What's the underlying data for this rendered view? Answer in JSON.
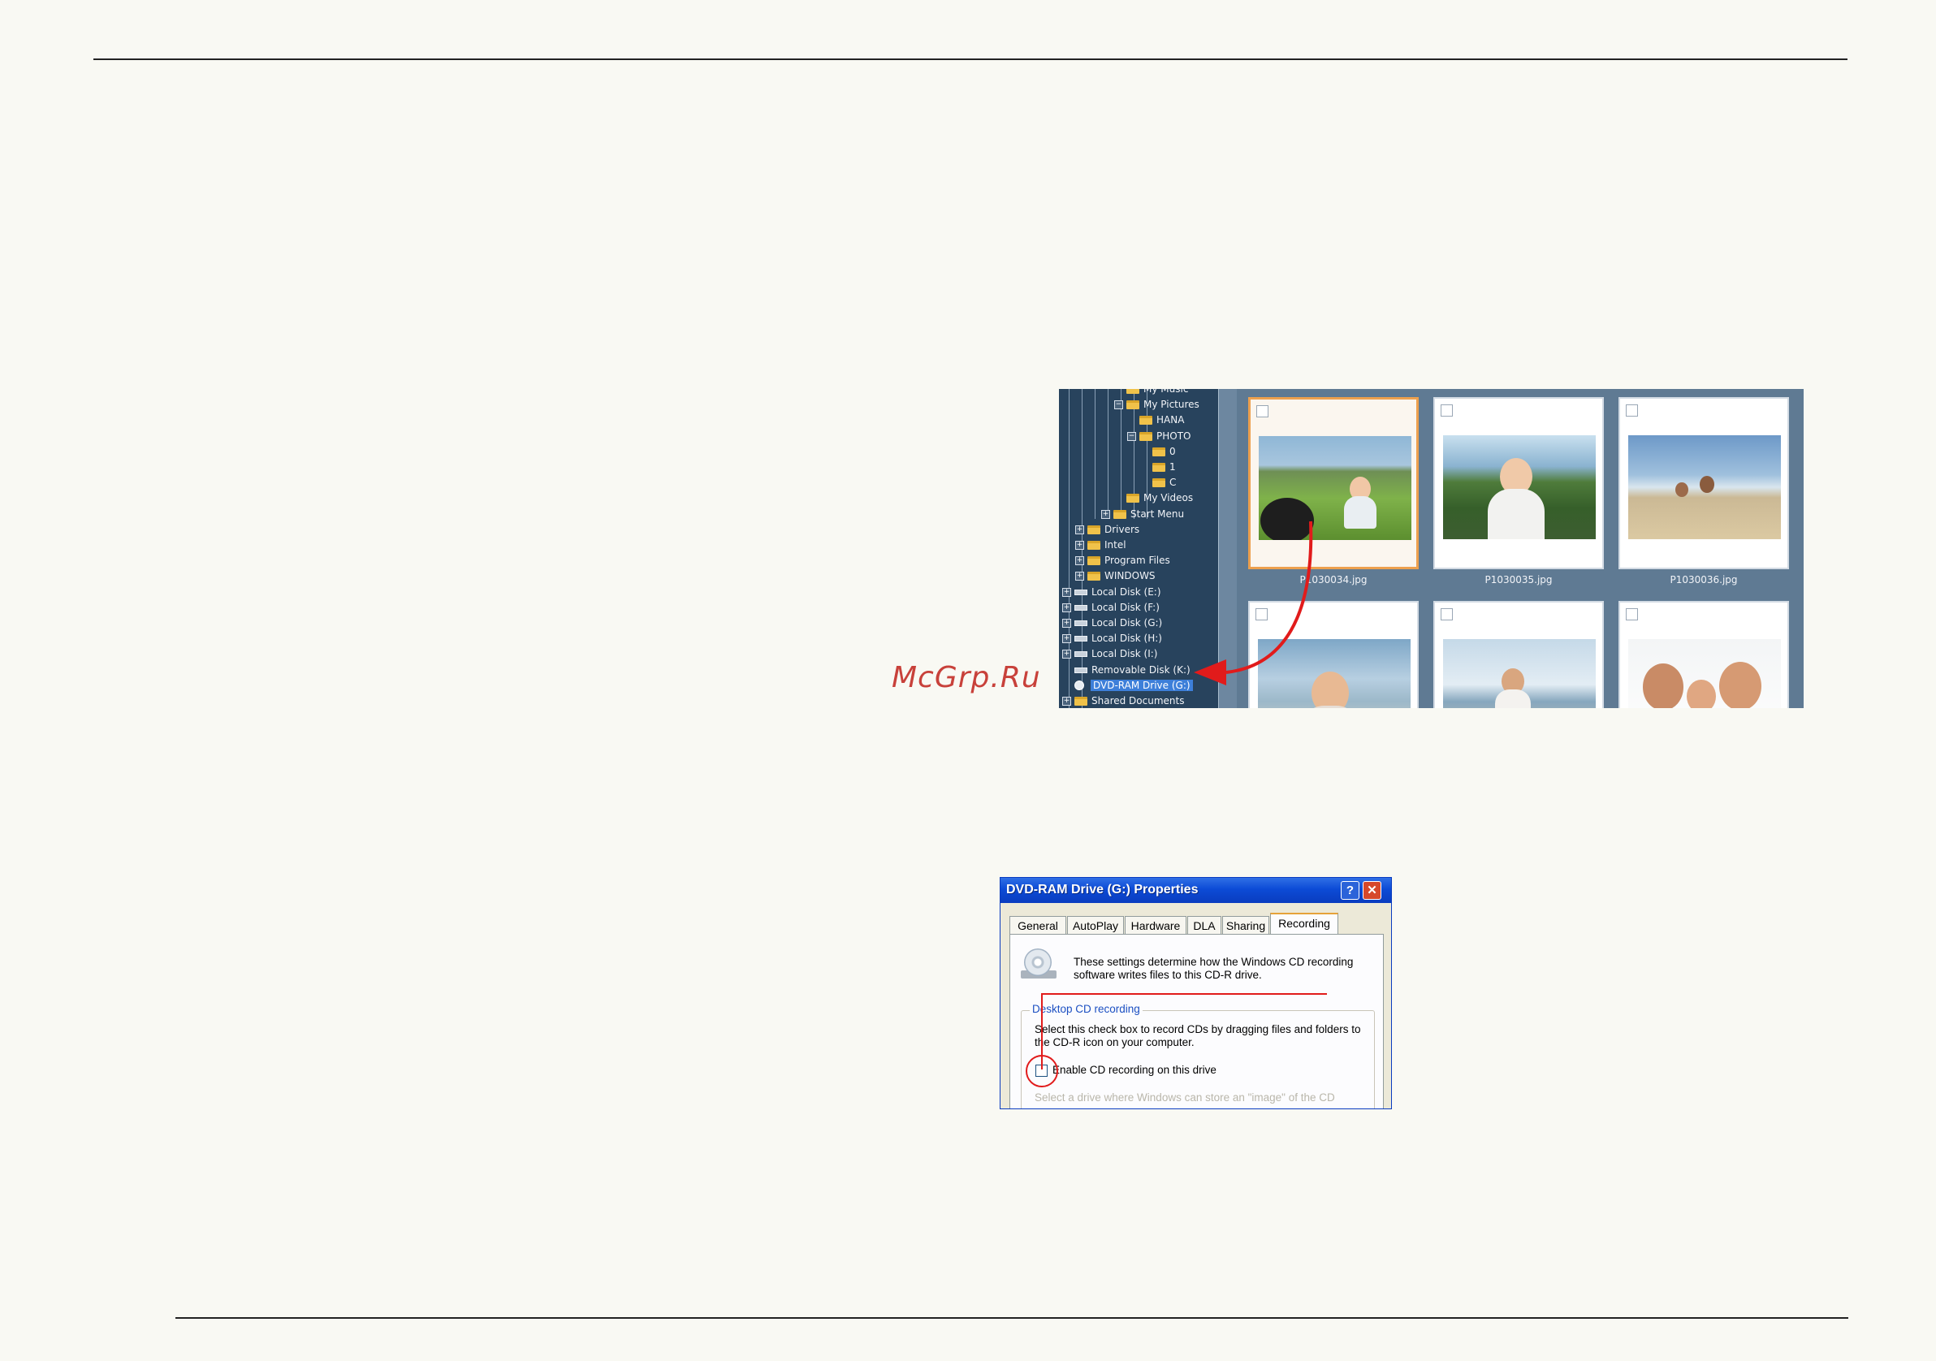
{
  "watermark": "McGrp.Ru",
  "explorer": {
    "tree": [
      {
        "label": "My Music",
        "depth": 4,
        "icon": "folder"
      },
      {
        "label": "My Pictures",
        "depth": 4,
        "icon": "folder",
        "expander": "−"
      },
      {
        "label": "HANA",
        "depth": 5,
        "icon": "folder"
      },
      {
        "label": "PHOTO",
        "depth": 5,
        "icon": "folder",
        "expander": "−"
      },
      {
        "label": "0",
        "depth": 6,
        "icon": "folder"
      },
      {
        "label": "1",
        "depth": 6,
        "icon": "folder"
      },
      {
        "label": "C",
        "depth": 6,
        "icon": "folder"
      },
      {
        "label": "My Videos",
        "depth": 4,
        "icon": "folder"
      },
      {
        "label": "Start Menu",
        "depth": 3,
        "icon": "folder",
        "expander": "+"
      },
      {
        "label": "Drivers",
        "depth": 1,
        "icon": "folder",
        "expander": "+"
      },
      {
        "label": "Intel",
        "depth": 1,
        "icon": "folder",
        "expander": "+"
      },
      {
        "label": "Program Files",
        "depth": 1,
        "icon": "folder",
        "expander": "+"
      },
      {
        "label": "WINDOWS",
        "depth": 1,
        "icon": "folder",
        "expander": "+"
      },
      {
        "label": "Local Disk (E:)",
        "depth": 0,
        "icon": "drive",
        "expander": "+"
      },
      {
        "label": "Local Disk (F:)",
        "depth": 0,
        "icon": "drive",
        "expander": "+"
      },
      {
        "label": "Local Disk (G:)",
        "depth": 0,
        "icon": "drive",
        "expander": "+"
      },
      {
        "label": "Local Disk (H:)",
        "depth": 0,
        "icon": "drive",
        "expander": "+"
      },
      {
        "label": "Local Disk (I:)",
        "depth": 0,
        "icon": "drive",
        "expander": "+"
      },
      {
        "label": "Removable Disk (K:)",
        "depth": 0,
        "icon": "drive"
      },
      {
        "label": "DVD-RAM Drive (G:)",
        "depth": 0,
        "icon": "disc",
        "selected": true
      },
      {
        "label": "Shared Documents",
        "depth": 0,
        "icon": "folder",
        "expander": "+"
      }
    ],
    "thumbnails": [
      {
        "filename": "P1030034.jpg",
        "selected": true
      },
      {
        "filename": "P1030035.jpg",
        "selected": false
      },
      {
        "filename": "P1030036.jpg",
        "selected": false
      },
      {
        "filename": "",
        "selected": false
      },
      {
        "filename": "",
        "selected": false
      },
      {
        "filename": "",
        "selected": false
      }
    ]
  },
  "dialog": {
    "title": "DVD-RAM Drive (G:) Properties",
    "help_button": "?",
    "close_button": "✕",
    "tabs": [
      "General",
      "AutoPlay",
      "Hardware",
      "DLA",
      "Sharing",
      "Recording"
    ],
    "active_tab": "Recording",
    "intro_text": "These settings determine how the Windows CD recording software writes files to this CD-R drive.",
    "group_title": "Desktop CD recording",
    "group_description": "Select this check box to record CDs by dragging files and folders to the CD-R icon on your computer.",
    "checkbox_label": "Enable CD recording on this drive",
    "checkbox_checked": false,
    "image_description": "Select a drive where Windows can store an \"image\" of the CD"
  },
  "colors": {
    "annotation_red": "#e11b1b",
    "selection_orange": "#eda04e",
    "xp_title_blue": "#0c4bd6"
  }
}
